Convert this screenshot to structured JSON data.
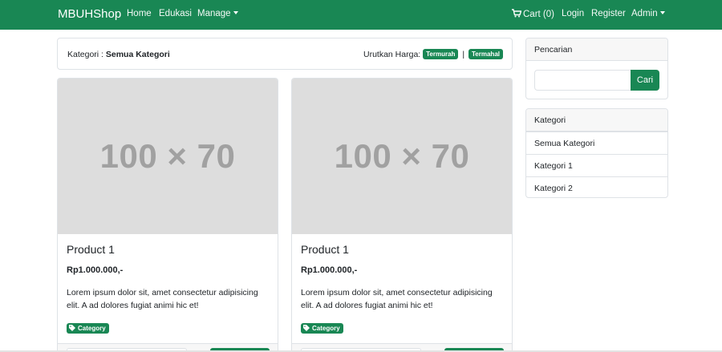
{
  "navbar": {
    "brand": "MBUHShop",
    "left_links": [
      "Home",
      "Edukasi",
      "Manage"
    ],
    "cart_label": "Cart (0)",
    "login_label": "Login",
    "register_label": "Register",
    "admin_label": "Admin",
    "cart_icon": "shopping-cart-icon",
    "background": "#198754"
  },
  "filter": {
    "category_prefix": "Kategori : ",
    "category_value": "Semua Kategori",
    "sort_label": "Urutkan Harga:",
    "sort_cheapest": "Termurah",
    "sort_separator": "|",
    "sort_most_expensive": "Termahal"
  },
  "products": [
    {
      "image_placeholder": "100 × 70",
      "title": "Product 1",
      "price": "Rp1.000.000,-",
      "description": "Lorem ipsum dolor sit, amet consectetur adipisicing elit. A ad dolores fugiat animi hic et!",
      "category_badge": "Category",
      "badge_icon": "tag-icon"
    },
    {
      "image_placeholder": "100 × 70",
      "title": "Product 1",
      "price": "Rp1.000.000,-",
      "description": "Lorem ipsum dolor sit, amet consectetur adipisicing elit. A ad dolores fugiat animi hic et!",
      "category_badge": "Category",
      "badge_icon": "tag-icon"
    }
  ],
  "sidebar": {
    "search": {
      "title": "Pencarian",
      "input_value": "",
      "button_label": "Cari"
    },
    "categories": {
      "title": "Kategori",
      "items": [
        "Semua Kategori",
        "Kategori 1",
        "Kategori 2"
      ]
    }
  },
  "colors": {
    "primary": "#198754",
    "placeholder_bg": "#dddddd",
    "placeholder_text": "#a1a1a1",
    "border": "#dee2e6"
  }
}
